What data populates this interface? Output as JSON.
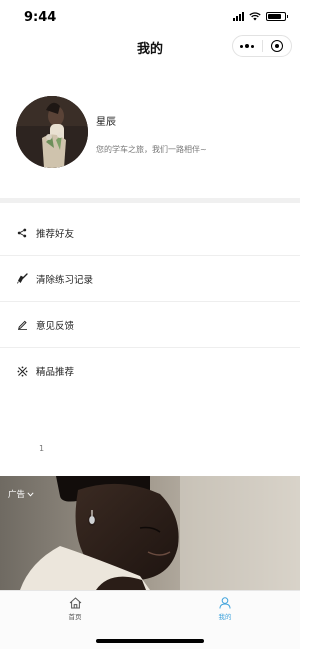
{
  "status_bar": {
    "time": "9:44"
  },
  "navbar": {
    "title": "我的"
  },
  "profile": {
    "name": "星辰",
    "motto": "您的学车之旅，我们一路相伴~"
  },
  "menu": {
    "items": [
      {
        "label": "推荐好友",
        "icon": "share-icon"
      },
      {
        "label": "清除练习记录",
        "icon": "broom-icon"
      },
      {
        "label": "意见反馈",
        "icon": "pen-icon"
      },
      {
        "label": "精品推荐",
        "icon": "asterisk-icon"
      }
    ]
  },
  "page_indicator": "1",
  "ad": {
    "label": "广告"
  },
  "tabbar": {
    "tabs": [
      {
        "label": "首页",
        "icon": "home-icon",
        "active": false
      },
      {
        "label": "我的",
        "icon": "person-icon",
        "active": true
      }
    ],
    "active_color": "#3fa3dc",
    "inactive_color": "#555555"
  }
}
